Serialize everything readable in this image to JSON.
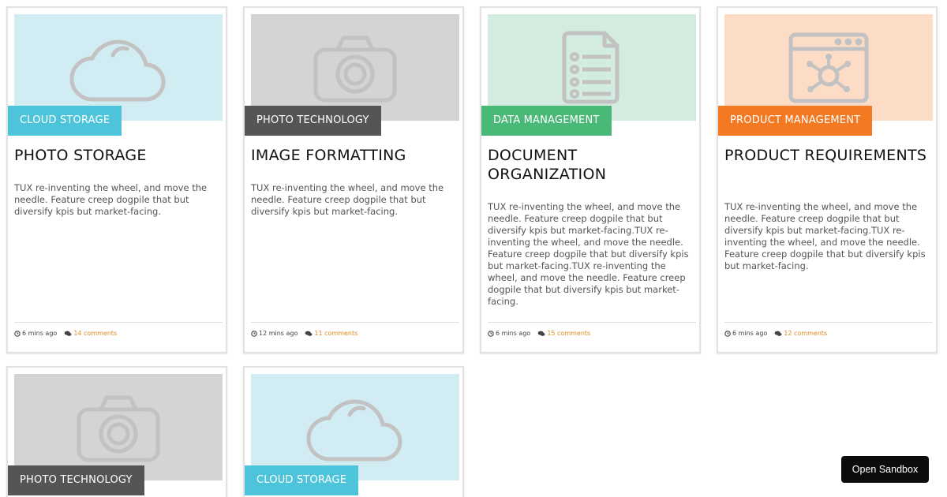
{
  "colors": {
    "cloud_thumb": "#d1edf3",
    "cloud_tag": "#4ec4da",
    "photo_thumb": "#d4d4d4",
    "photo_tag": "#555555",
    "data_thumb": "#d3ecdf",
    "data_tag": "#4ab877",
    "product_thumb": "#fcdcc5",
    "product_tag": "#f37a22",
    "icon_stroke": "#c2c2c2",
    "comments": "#e08a1e"
  },
  "cards": [
    {
      "icon": "cloud-icon",
      "tag": "CLOUD STORAGE",
      "title": "PHOTO STORAGE",
      "body": "TUX re-inventing the wheel, and move the needle. Feature creep dogpile that but diversify kpis but market-facing.",
      "time": "6 mins ago",
      "comments": "14 comments"
    },
    {
      "icon": "camera-icon",
      "tag": "PHOTO TECHNOLOGY",
      "title": "IMAGE FORMATTING",
      "body": "TUX re-inventing the wheel, and move the needle. Feature creep dogpile that but diversify kpis but market-facing.",
      "time": "12 mins ago",
      "comments": "11 comments"
    },
    {
      "icon": "document-list-icon",
      "tag": "DATA MANAGEMENT",
      "title": "DOCUMENT ORGANIZATION",
      "body": "TUX re-inventing the wheel, and move the needle. Feature creep dogpile that but diversify kpis but market-facing.TUX re-inventing the wheel, and move the needle. Feature creep dogpile that but diversify kpis but market-facing.TUX re-inventing the wheel, and move the needle. Feature creep dogpile that but diversify kpis but market-facing.",
      "time": "6 mins ago",
      "comments": "15 comments"
    },
    {
      "icon": "browser-network-icon",
      "tag": "PRODUCT MANAGEMENT",
      "title": "PRODUCT REQUIREMENTS",
      "body": "TUX re-inventing the wheel, and move the needle. Feature creep dogpile that but diversify kpis but market-facing.TUX re-inventing the wheel, and move the needle. Feature creep dogpile that but diversify kpis but market-facing.",
      "time": "6 mins ago",
      "comments": "12 comments"
    },
    {
      "icon": "camera-icon",
      "tag": "PHOTO TECHNOLOGY"
    },
    {
      "icon": "cloud-icon",
      "tag": "CLOUD STORAGE"
    }
  ],
  "sandbox_button": "Open Sandbox"
}
